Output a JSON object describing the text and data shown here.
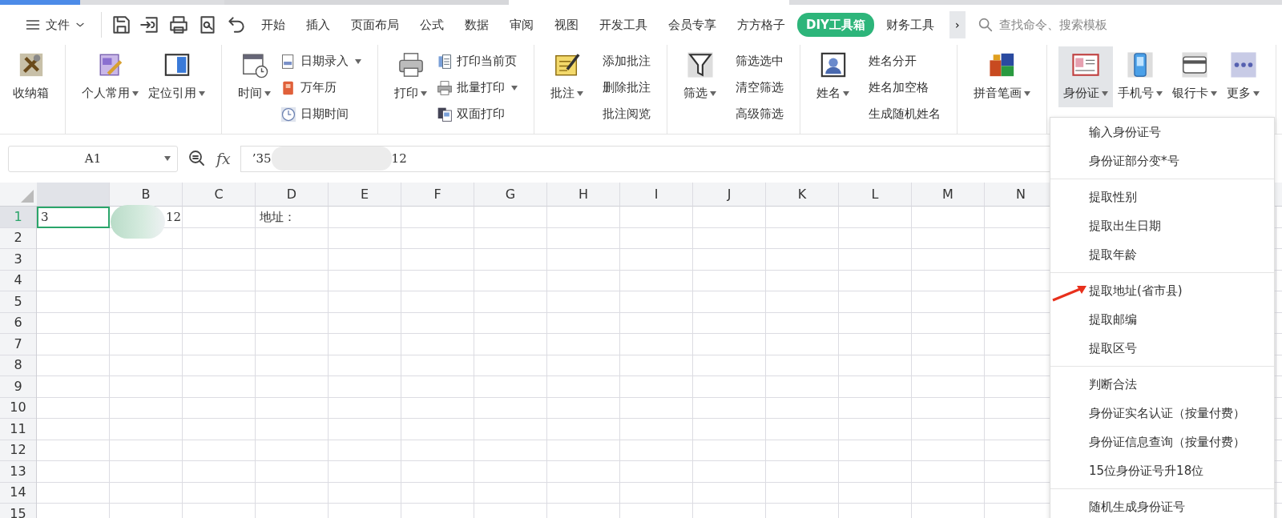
{
  "menu_bar": {
    "file_label": "文件",
    "tabs": [
      {
        "label": "开始",
        "selected": false
      },
      {
        "label": "插入",
        "selected": false
      },
      {
        "label": "页面布局",
        "selected": false
      },
      {
        "label": "公式",
        "selected": false
      },
      {
        "label": "数据",
        "selected": false
      },
      {
        "label": "审阅",
        "selected": false
      },
      {
        "label": "视图",
        "selected": false
      },
      {
        "label": "开发工具",
        "selected": false
      },
      {
        "label": "会员专享",
        "selected": false
      },
      {
        "label": "方方格子",
        "selected": false
      },
      {
        "label": "DIY工具箱",
        "selected": true
      },
      {
        "label": "财务工具",
        "selected": false
      }
    ],
    "more_button": "›",
    "search": {
      "placeholder": "查找命令、搜索模板"
    }
  },
  "ribbon": {
    "groups": [
      {
        "items": [
          {
            "kind": "large",
            "label": "收纳箱",
            "dropdown": false,
            "selected": false
          }
        ]
      },
      {
        "items": [
          {
            "kind": "large",
            "label": "个人常用",
            "dropdown": true,
            "selected": false
          },
          {
            "kind": "large",
            "label": "定位引用",
            "dropdown": true,
            "selected": false
          }
        ]
      },
      {
        "items": [
          {
            "kind": "large",
            "label": "时间",
            "dropdown": true,
            "selected": false
          },
          {
            "kind": "stack",
            "entries": [
              {
                "label": "日期录入",
                "dropdown": true
              },
              {
                "label": "万年历",
                "dropdown": false
              },
              {
                "label": "日期时间",
                "dropdown": false
              }
            ]
          }
        ]
      },
      {
        "items": [
          {
            "kind": "large",
            "label": "打印",
            "dropdown": true,
            "selected": false
          },
          {
            "kind": "stack",
            "entries": [
              {
                "label": "打印当前页",
                "dropdown": false
              },
              {
                "label": "批量打印",
                "dropdown": true
              },
              {
                "label": "双面打印",
                "dropdown": false
              }
            ]
          }
        ]
      },
      {
        "items": [
          {
            "kind": "large",
            "label": "批注",
            "dropdown": true,
            "selected": false
          },
          {
            "kind": "stack",
            "entries": [
              {
                "label": "添加批注",
                "dropdown": false
              },
              {
                "label": "删除批注",
                "dropdown": false
              },
              {
                "label": "批注阅览",
                "dropdown": false
              }
            ]
          }
        ]
      },
      {
        "items": [
          {
            "kind": "large",
            "label": "筛选",
            "dropdown": true,
            "selected": false
          },
          {
            "kind": "stack",
            "entries": [
              {
                "label": "筛选选中",
                "dropdown": false
              },
              {
                "label": "清空筛选",
                "dropdown": false
              },
              {
                "label": "高级筛选",
                "dropdown": false
              }
            ]
          }
        ]
      },
      {
        "items": [
          {
            "kind": "large",
            "label": "姓名",
            "dropdown": true,
            "selected": false
          },
          {
            "kind": "stack",
            "entries": [
              {
                "label": "姓名分开",
                "dropdown": false
              },
              {
                "label": "姓名加空格",
                "dropdown": false
              },
              {
                "label": "生成随机姓名",
                "dropdown": false
              }
            ]
          }
        ]
      },
      {
        "items": [
          {
            "kind": "large",
            "label": "拼音笔画",
            "dropdown": true,
            "selected": false
          }
        ]
      },
      {
        "items": [
          {
            "kind": "large",
            "label": "身份证",
            "dropdown": true,
            "selected": true
          },
          {
            "kind": "large",
            "label": "手机号",
            "dropdown": true,
            "selected": false
          },
          {
            "kind": "large",
            "label": "银行卡",
            "dropdown": true,
            "selected": false
          },
          {
            "kind": "large",
            "label": "更多",
            "dropdown": true,
            "selected": false
          }
        ]
      }
    ]
  },
  "formula_bar": {
    "name_box": "A1",
    "fx_label": "fx",
    "formula_start": "’35",
    "formula_end": "12"
  },
  "sheet": {
    "columns": [
      "B",
      "C",
      "D",
      "E",
      "F",
      "G",
      "H",
      "I",
      "J",
      "K",
      "L",
      "M",
      "N"
    ],
    "rows": [
      {
        "label": "1",
        "selected": true
      },
      {
        "label": "2",
        "selected": false
      },
      {
        "label": "3",
        "selected": false
      },
      {
        "label": "4",
        "selected": false
      },
      {
        "label": "5",
        "selected": false
      },
      {
        "label": "6",
        "selected": false
      },
      {
        "label": "7",
        "selected": false
      },
      {
        "label": "8",
        "selected": false
      },
      {
        "label": "9",
        "selected": false
      },
      {
        "label": "10",
        "selected": false
      },
      {
        "label": "11",
        "selected": false
      },
      {
        "label": "12",
        "selected": false
      },
      {
        "label": "13",
        "selected": false
      },
      {
        "label": "14",
        "selected": false
      },
      {
        "label": "15",
        "selected": false
      }
    ],
    "row_1_cells": {
      "A": {
        "text": "3",
        "selected": true
      },
      "B": {
        "text": "12",
        "selected": false
      },
      "D": {
        "text": "地址：",
        "selected": false
      }
    }
  },
  "dropdown_menu": {
    "groups": [
      [
        "输入身份证号",
        "身份证部分变*号"
      ],
      [
        "提取性别",
        "提取出生日期",
        "提取年龄"
      ],
      [
        "提取地址(省市县)",
        "提取邮编",
        "提取区号"
      ],
      [
        "判断合法",
        "身份证实名认证（按量付费）",
        "身份证信息查询（按量付费）",
        "15位身份证号升18位"
      ],
      [
        "随机生成身份证号"
      ]
    ]
  }
}
